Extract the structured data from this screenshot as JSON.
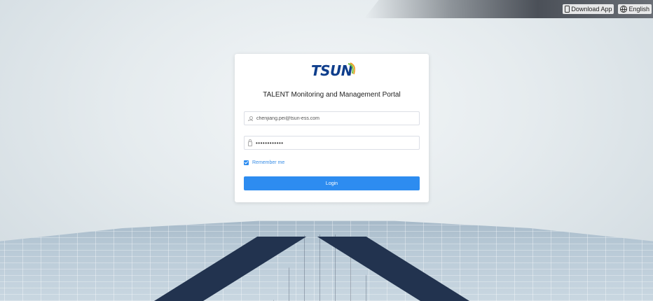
{
  "topbar": {
    "download_label": "Download App",
    "language_label": "English"
  },
  "login": {
    "logo_text": "TSUN",
    "title": "TALENT Monitoring and Management Portal",
    "username_value": "chenjiang.pei@tsun-ess.com",
    "password_value": "••••••••••••",
    "remember_label": "Remember me",
    "remember_checked": true,
    "login_label": "Login"
  },
  "colors": {
    "primary": "#2d8cf0",
    "logo_blue": "#0f3e8c",
    "logo_arc_green": "#7cc142",
    "logo_arc_orange": "#f29a1d"
  }
}
